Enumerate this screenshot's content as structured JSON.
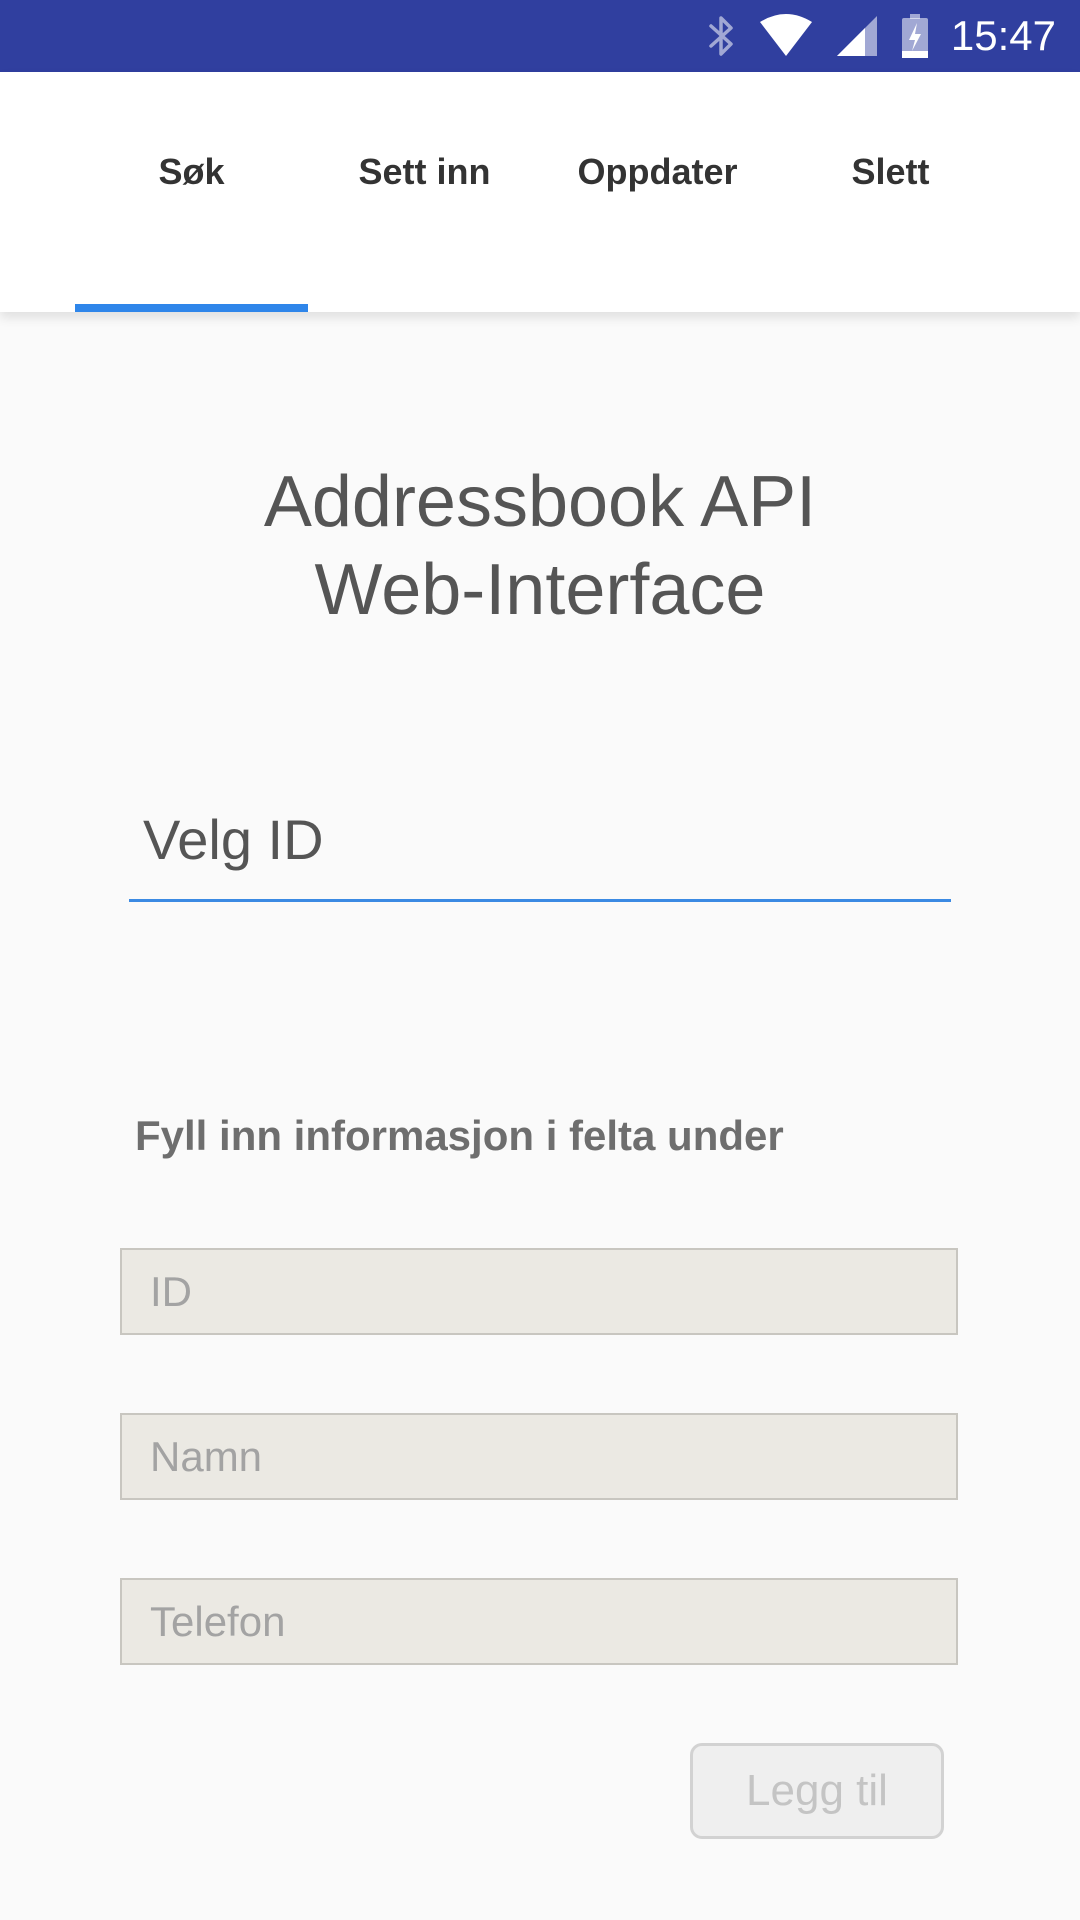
{
  "status_bar": {
    "time": "15:47",
    "icons": [
      "bluetooth-icon",
      "wifi-icon",
      "cell-signal-icon",
      "battery-charging-icon"
    ],
    "background": "#303f9f"
  },
  "tabs": [
    {
      "label": "Søk",
      "selected": true
    },
    {
      "label": "Sett inn",
      "selected": false
    },
    {
      "label": "Oppdater",
      "selected": false
    },
    {
      "label": "Slett",
      "selected": false
    }
  ],
  "accent_color": "#2f86ea",
  "main": {
    "title_line1": "Addressbook API",
    "title_line2": "Web-Interface",
    "select_id_label": "Velg ID",
    "form_heading": "Fyll inn informasjon i felta under",
    "fields": {
      "id": {
        "placeholder": "ID",
        "value": ""
      },
      "name": {
        "placeholder": "Namn",
        "value": ""
      },
      "phone": {
        "placeholder": "Telefon",
        "value": ""
      }
    },
    "add_button_label": "Legg til"
  }
}
